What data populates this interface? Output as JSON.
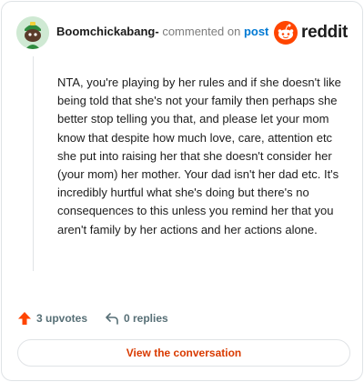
{
  "header": {
    "username": "Boomchickabang-",
    "action_text": "commented on",
    "target_link": "post",
    "brand_name": "reddit"
  },
  "comment": {
    "body": "NTA, you're playing by her rules and if she doesn't like being told that she's not your family then perhaps she better stop telling you that, and please let your mom know that despite how much love, care, attention etc she put into raising her that she doesn't consider her (your mom) her mother. Your dad isn't her dad etc. It's incredibly hurtful what she's doing but there's no consequences to this unless you remind her that you aren't family by her actions and her actions alone."
  },
  "actions": {
    "upvotes_label": "3 upvotes",
    "replies_label": "0 replies"
  },
  "footer": {
    "view_button_label": "View the conversation"
  },
  "icons": {
    "upvote": "upvote-arrow-icon",
    "reply": "reply-arrow-icon",
    "brand": "reddit-snoo-icon",
    "avatar": "snoo-avatar"
  },
  "colors": {
    "accent": "#ff4500",
    "link": "#0079d3",
    "button_text": "#d93a00",
    "muted": "#576f76"
  }
}
